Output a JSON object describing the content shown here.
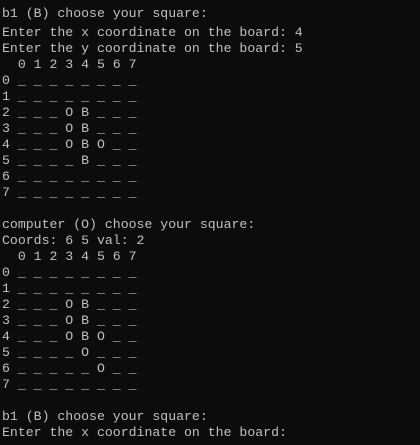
{
  "console": {
    "lines": [
      "b1 (B) choose your square:",
      "Enter the x coordinate on the board: 4",
      "Enter the y coordinate on the board: 5",
      "  0 1 2 3 4 5 6 7",
      "0 _ _ _ _ _ _ _ _",
      "1 _ _ _ _ _ _ _ _",
      "2 _ _ _ O B _ _ _",
      "3 _ _ _ O B _ _ _",
      "4 _ _ _ O B O _ _",
      "5 _ _ _ _ B _ _ _",
      "6 _ _ _ _ _ _ _ _",
      "7 _ _ _ _ _ _ _ _",
      "",
      "computer (O) choose your square:",
      "Coords: 6 5 val: 2",
      "  0 1 2 3 4 5 6 7",
      "0 _ _ _ _ _ _ _ _",
      "1 _ _ _ _ _ _ _ _",
      "2 _ _ _ O B _ _ _",
      "3 _ _ _ O B _ _ _",
      "4 _ _ _ O B O _ _",
      "5 _ _ _ _ O _ _ _",
      "6 _ _ _ _ _ O _ _",
      "7 _ _ _ _ _ _ _ _",
      "",
      "b1 (B) choose your square:",
      "Enter the x coordinate on the board:"
    ]
  }
}
